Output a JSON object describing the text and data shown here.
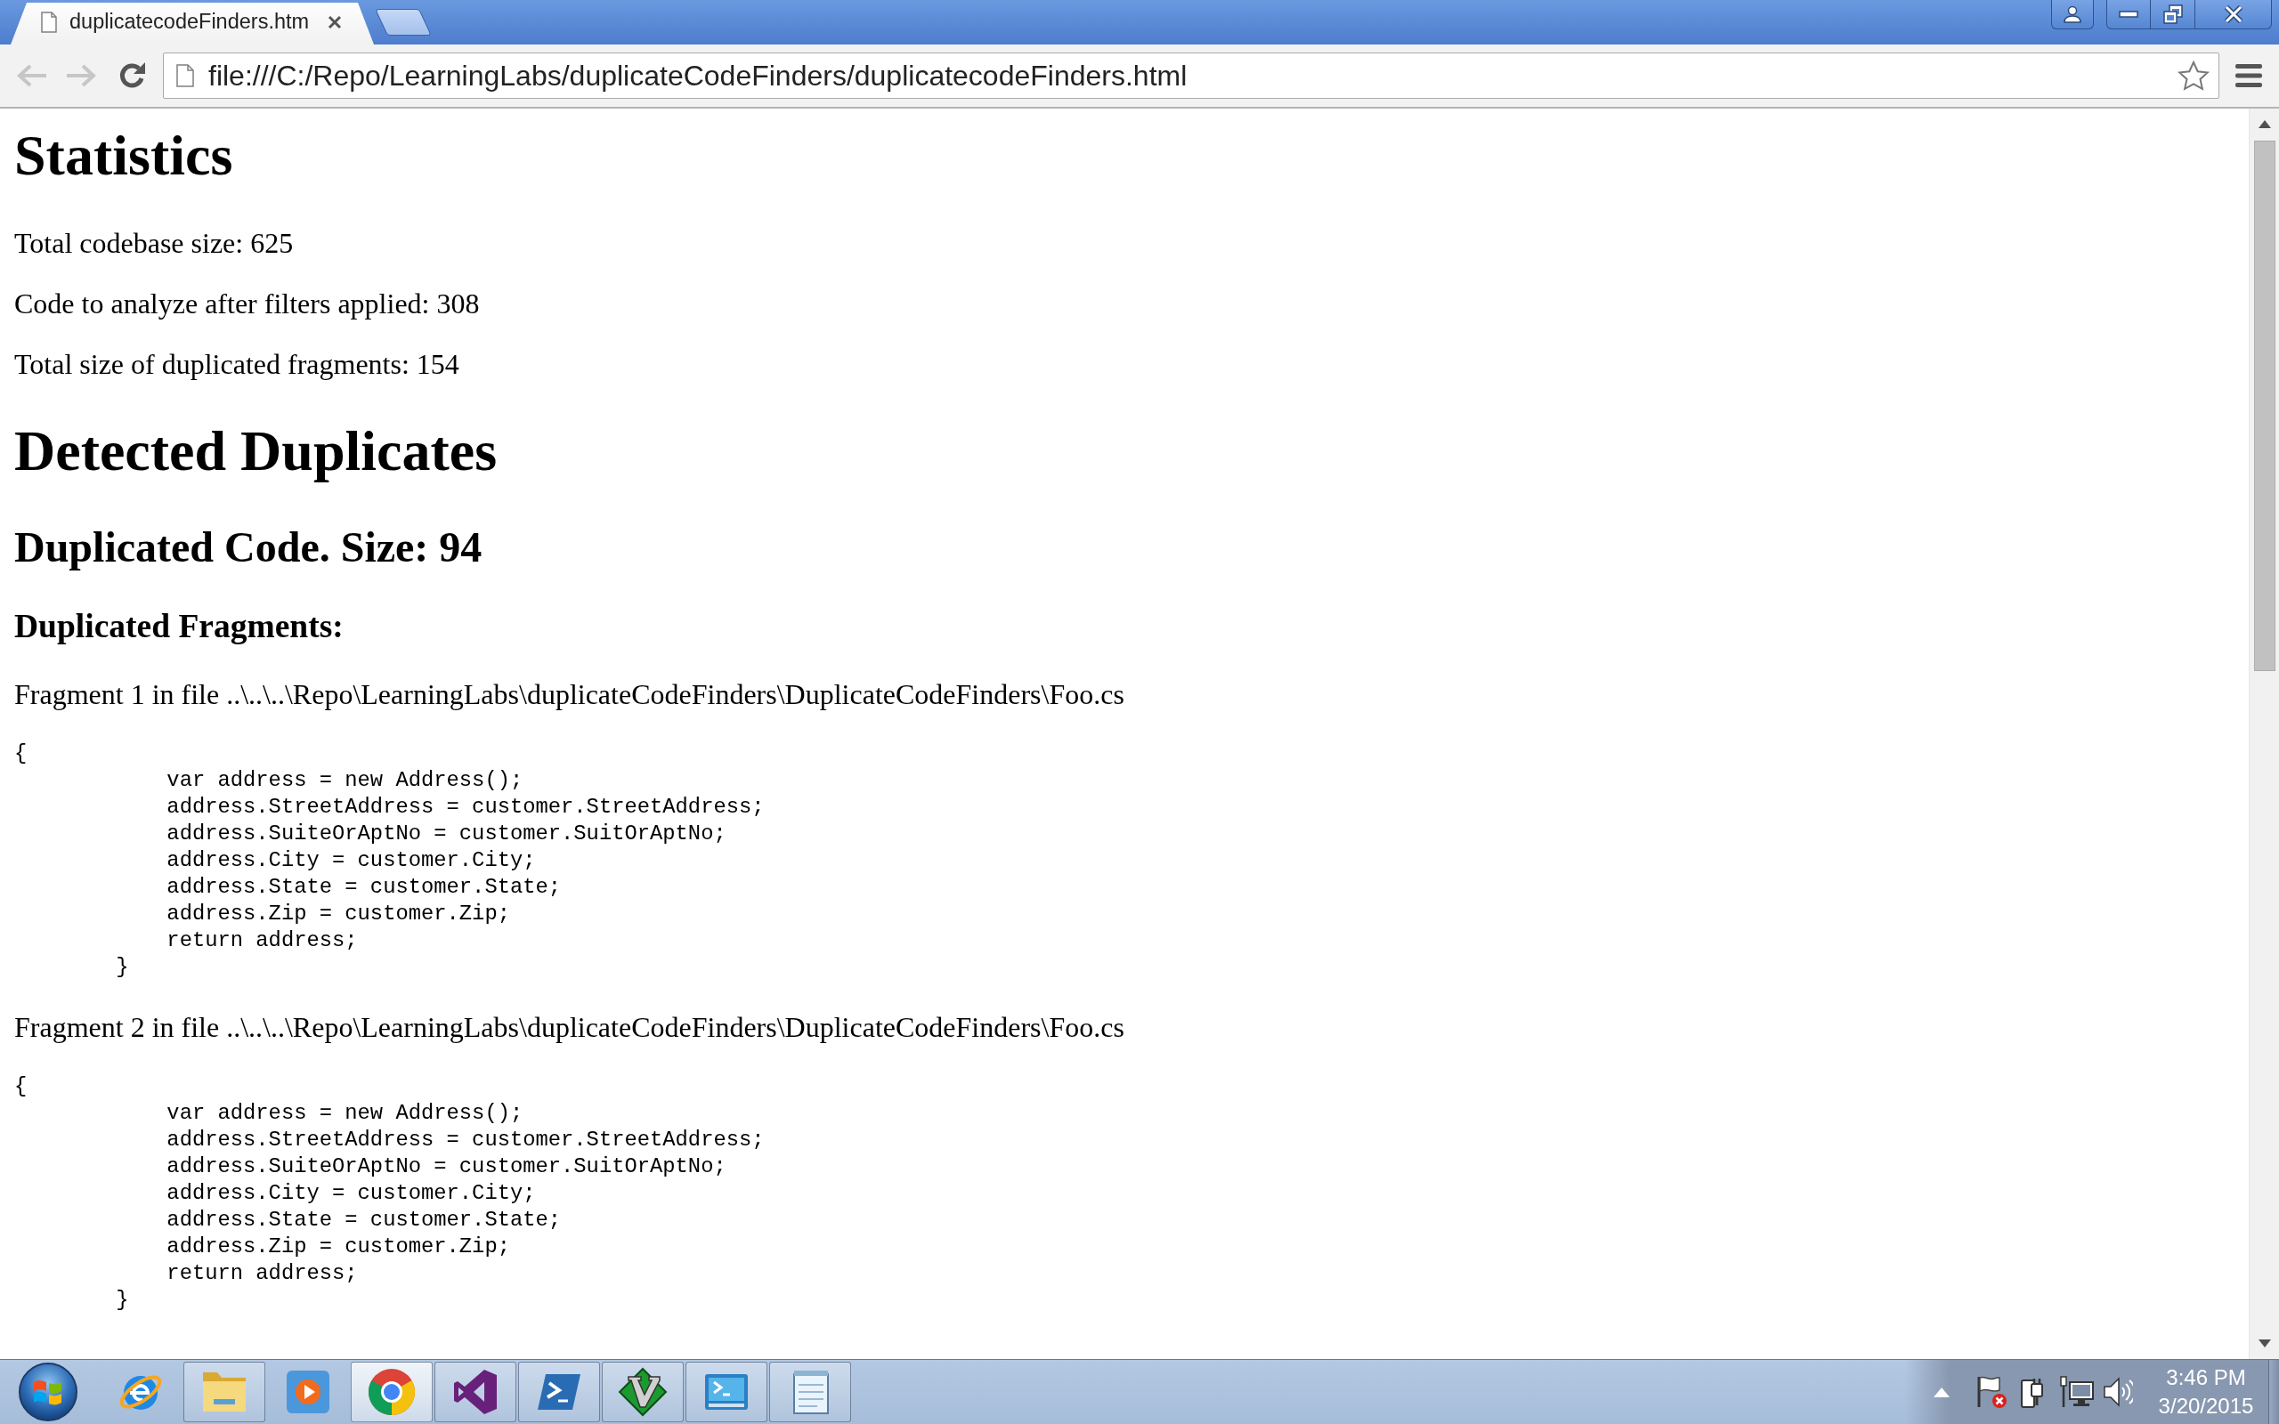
{
  "window": {
    "tabs": [
      {
        "title": "duplicatecodeFinders.htm",
        "selected": true
      }
    ]
  },
  "toolbar": {
    "back": {
      "disabled": true
    },
    "forward": {
      "disabled": true
    },
    "address": "file:///C:/Repo/LearningLabs/duplicateCodeFinders/duplicatecodeFinders.html"
  },
  "page": {
    "blocks": [
      {
        "kind": "h1",
        "text": "Statistics"
      },
      {
        "kind": "p",
        "text": "Total codebase size: 625"
      },
      {
        "kind": "p",
        "text": "Code to analyze after filters applied: 308"
      },
      {
        "kind": "p",
        "text": "Total size of duplicated fragments: 154"
      },
      {
        "kind": "h1",
        "text": "Detected Duplicates"
      },
      {
        "kind": "h2",
        "text": "Duplicated Code. Size: 94"
      },
      {
        "kind": "h3",
        "text": "Duplicated Fragments:"
      },
      {
        "kind": "p",
        "text": "Fragment 1 in file ..\\..\\..\\Repo\\LearningLabs\\duplicateCodeFinders\\DuplicateCodeFinders\\Foo.cs"
      },
      {
        "kind": "code",
        "lines": [
          "{",
          "            var address = new Address();",
          "            address.StreetAddress = customer.StreetAddress;",
          "            address.SuiteOrAptNo = customer.SuitOrAptNo;",
          "            address.City = customer.City;",
          "            address.State = customer.State;",
          "            address.Zip = customer.Zip;",
          "            return address;",
          "        }"
        ]
      },
      {
        "kind": "p",
        "text": "Fragment 2 in file ..\\..\\..\\Repo\\LearningLabs\\duplicateCodeFinders\\DuplicateCodeFinders\\Foo.cs"
      },
      {
        "kind": "code",
        "lines": [
          "{",
          "            var address = new Address();",
          "            address.StreetAddress = customer.StreetAddress;",
          "            address.SuiteOrAptNo = customer.SuitOrAptNo;",
          "            address.City = customer.City;",
          "            address.State = customer.State;",
          "            address.Zip = customer.Zip;",
          "            return address;",
          "        }"
        ]
      }
    ]
  },
  "taskbar": {
    "apps": [
      {
        "kind": "eglobe",
        "running": false,
        "selected": false
      },
      {
        "kind": "folder",
        "running": true,
        "selected": false
      },
      {
        "kind": "player",
        "running": false,
        "selected": false
      },
      {
        "kind": "wheel",
        "running": true,
        "selected": true
      },
      {
        "kind": "infinity",
        "running": true,
        "selected": false
      },
      {
        "kind": "prompt",
        "running": true,
        "selected": false
      },
      {
        "kind": "diamond",
        "running": true,
        "selected": false
      },
      {
        "kind": "terminal",
        "running": true,
        "selected": false
      },
      {
        "kind": "notepad",
        "running": true,
        "selected": false
      }
    ],
    "clock": {
      "time": "3:46 PM",
      "date": "3/20/2015"
    }
  }
}
